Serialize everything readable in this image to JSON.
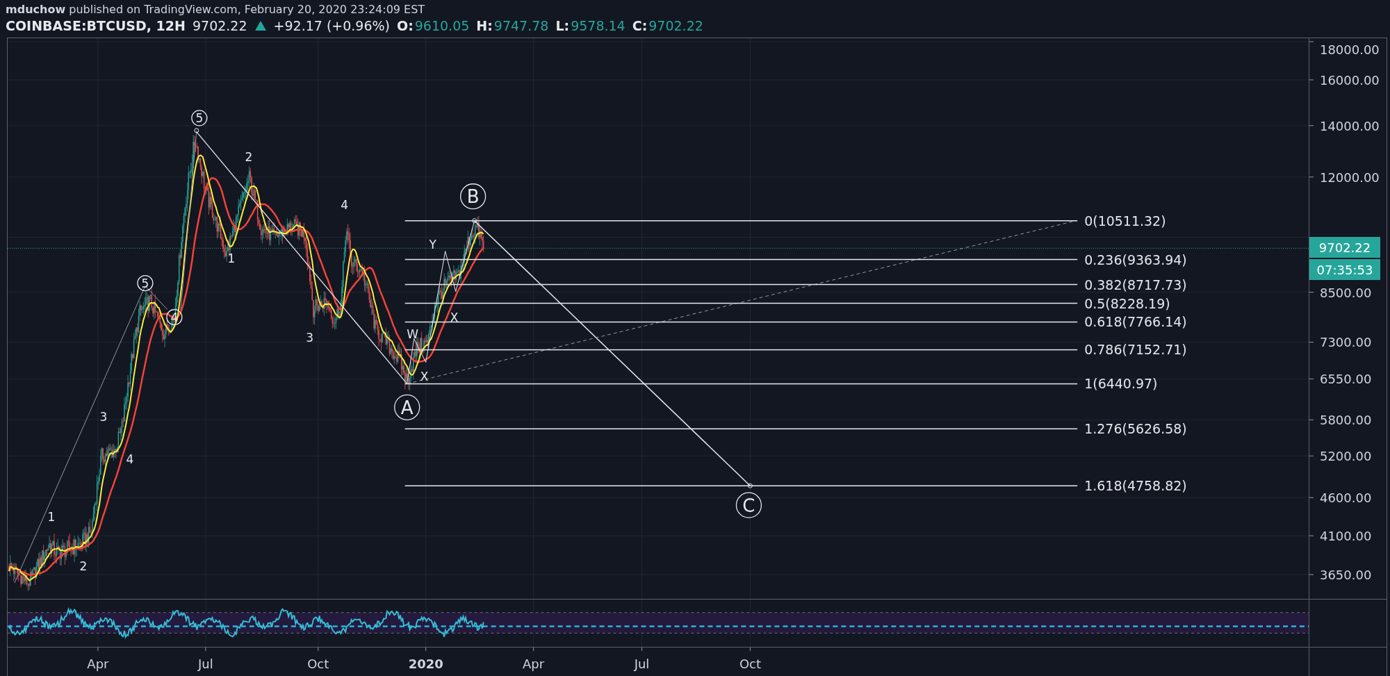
{
  "header": {
    "publisher_line": "**mduchow** published on TradingView.com, February 20, 2020 23:24:09 EST",
    "symbol": "COINBASE:BTCUSD, 12H",
    "last": "9702.22",
    "change": "+92.17 (+0.96%)",
    "ohlc": [
      {
        "label": "O:",
        "value": "9610.05"
      },
      {
        "label": "H:",
        "value": "9747.78"
      },
      {
        "label": "L:",
        "value": "9578.14"
      },
      {
        "label": "C:",
        "value": "9702.22"
      }
    ]
  },
  "fib_levels": [
    {
      "label": "0(10511.32)"
    },
    {
      "label": "0.236(9363.94)"
    },
    {
      "label": "0.382(8717.73)"
    },
    {
      "label": "0.5(8228.19)"
    },
    {
      "label": "0.618(7766.14)"
    },
    {
      "label": "0.786(7152.71)"
    },
    {
      "label": "1(6440.97)"
    },
    {
      "label": "1.276(5626.58)"
    },
    {
      "label": "1.618(4758.82)"
    }
  ],
  "wave_labels": [
    {
      "text": "1",
      "circled": false
    },
    {
      "text": "2",
      "circled": false
    },
    {
      "text": "3",
      "circled": false
    },
    {
      "text": "4",
      "circled": false
    },
    {
      "text": "5",
      "circled": true
    },
    {
      "text": "4",
      "circled": true
    },
    {
      "text": "5",
      "circled": true
    },
    {
      "text": "2",
      "circled": false
    },
    {
      "text": "1",
      "circled": false
    },
    {
      "text": "4",
      "circled": false
    },
    {
      "text": "3",
      "circled": false
    },
    {
      "text": "W",
      "circled": false
    },
    {
      "text": "X",
      "circled": false
    },
    {
      "text": "Y",
      "circled": false
    },
    {
      "text": "X",
      "circled": false
    },
    {
      "text": "A",
      "circled": true
    },
    {
      "text": "B",
      "circled": true
    },
    {
      "text": "C",
      "circled": true
    }
  ],
  "price_axis": {
    "labels": [
      "18000.00",
      "16000.00",
      "14000.00",
      "12000.00",
      "8500.00",
      "7300.00",
      "6550.00",
      "5800.00",
      "5200.00",
      "4600.00",
      "4100.00",
      "3650.00"
    ],
    "last_price": "9702.22",
    "countdown": "07:35:53"
  },
  "time_axis": {
    "labels": [
      {
        "text": "Apr",
        "bold": false
      },
      {
        "text": "Jul",
        "bold": false
      },
      {
        "text": "Oct",
        "bold": false
      },
      {
        "text": "2020",
        "bold": true
      },
      {
        "text": "Apr",
        "bold": false
      },
      {
        "text": "Jul",
        "bold": false
      },
      {
        "text": "Oct",
        "bold": false
      }
    ]
  }
}
